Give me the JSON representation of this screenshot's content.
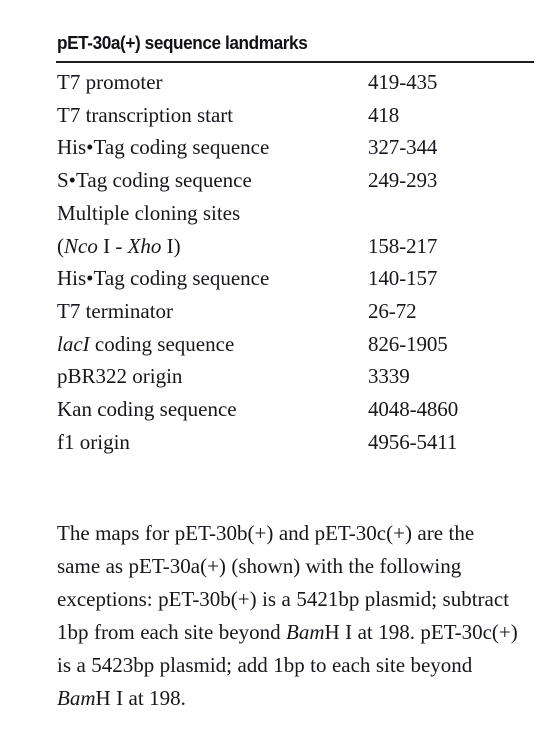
{
  "document": {
    "title": "pET-30a(+) sequence landmarks",
    "table": {
      "rows": [
        {
          "name": "T7 promoter",
          "value": "419-435"
        },
        {
          "name": "T7 transcription start",
          "value": "418"
        },
        {
          "name": "His•Tag coding sequence",
          "value": "327-344"
        },
        {
          "name": "S•Tag coding sequence",
          "value": "249-293"
        },
        {
          "name": "Multiple cloning sites",
          "value": ""
        },
        {
          "name": "(Nco I - Xho I)",
          "value": "158-217"
        },
        {
          "name": "His•Tag coding sequence",
          "value": "140-157"
        },
        {
          "name": "T7 terminator",
          "value": "26-72"
        },
        {
          "name": "lacI coding sequence",
          "value": "826-1905"
        },
        {
          "name": "pBR322 origin",
          "value": "3339"
        },
        {
          "name": "Kan coding sequence",
          "value": "4048-4860"
        },
        {
          "name": "f1 origin",
          "value": "4956-5411"
        }
      ]
    },
    "note": {
      "full_text": "The maps for pET-30b(+) and pET-30c(+) are the same as pET-30a(+) (shown) with the following exceptions: pET-30b(+) is a 5421bp plasmid; subtract 1bp from each site beyond BamH I at 198. pET-30c(+) is a 5423bp plasmid; add 1bp to each site beyond BamH I at 198.",
      "seg1": "The maps for pET-30b(+) and pET-30c(+) are the same as pET-30a(+) (shown) with the following exceptions: pET-30b(+) is a 5421bp plasmid; subtract 1bp from each site beyond ",
      "enzyme1_italic": "Bam",
      "enzyme1_roman": "H I",
      "seg2": " at 198. pET-30c(+) is a 5423bp plasmid; add 1bp to each site beyond ",
      "enzyme2_italic": "Bam",
      "enzyme2_roman": "H I",
      "seg3": " at 198."
    },
    "mcs_row": {
      "open_paren": "(",
      "enzyme_a_italic": "Nco",
      "enzyme_a_roman": " I",
      "separator": " - ",
      "enzyme_b_italic": "Xho",
      "enzyme_b_roman": " I",
      "close_paren": ")"
    },
    "laci_row": {
      "gene_italic": "lacI",
      "rest": " coding sequence"
    },
    "colors": {
      "text": "#16161e",
      "rule": "#1b1b22",
      "background": "#ffffff"
    }
  }
}
